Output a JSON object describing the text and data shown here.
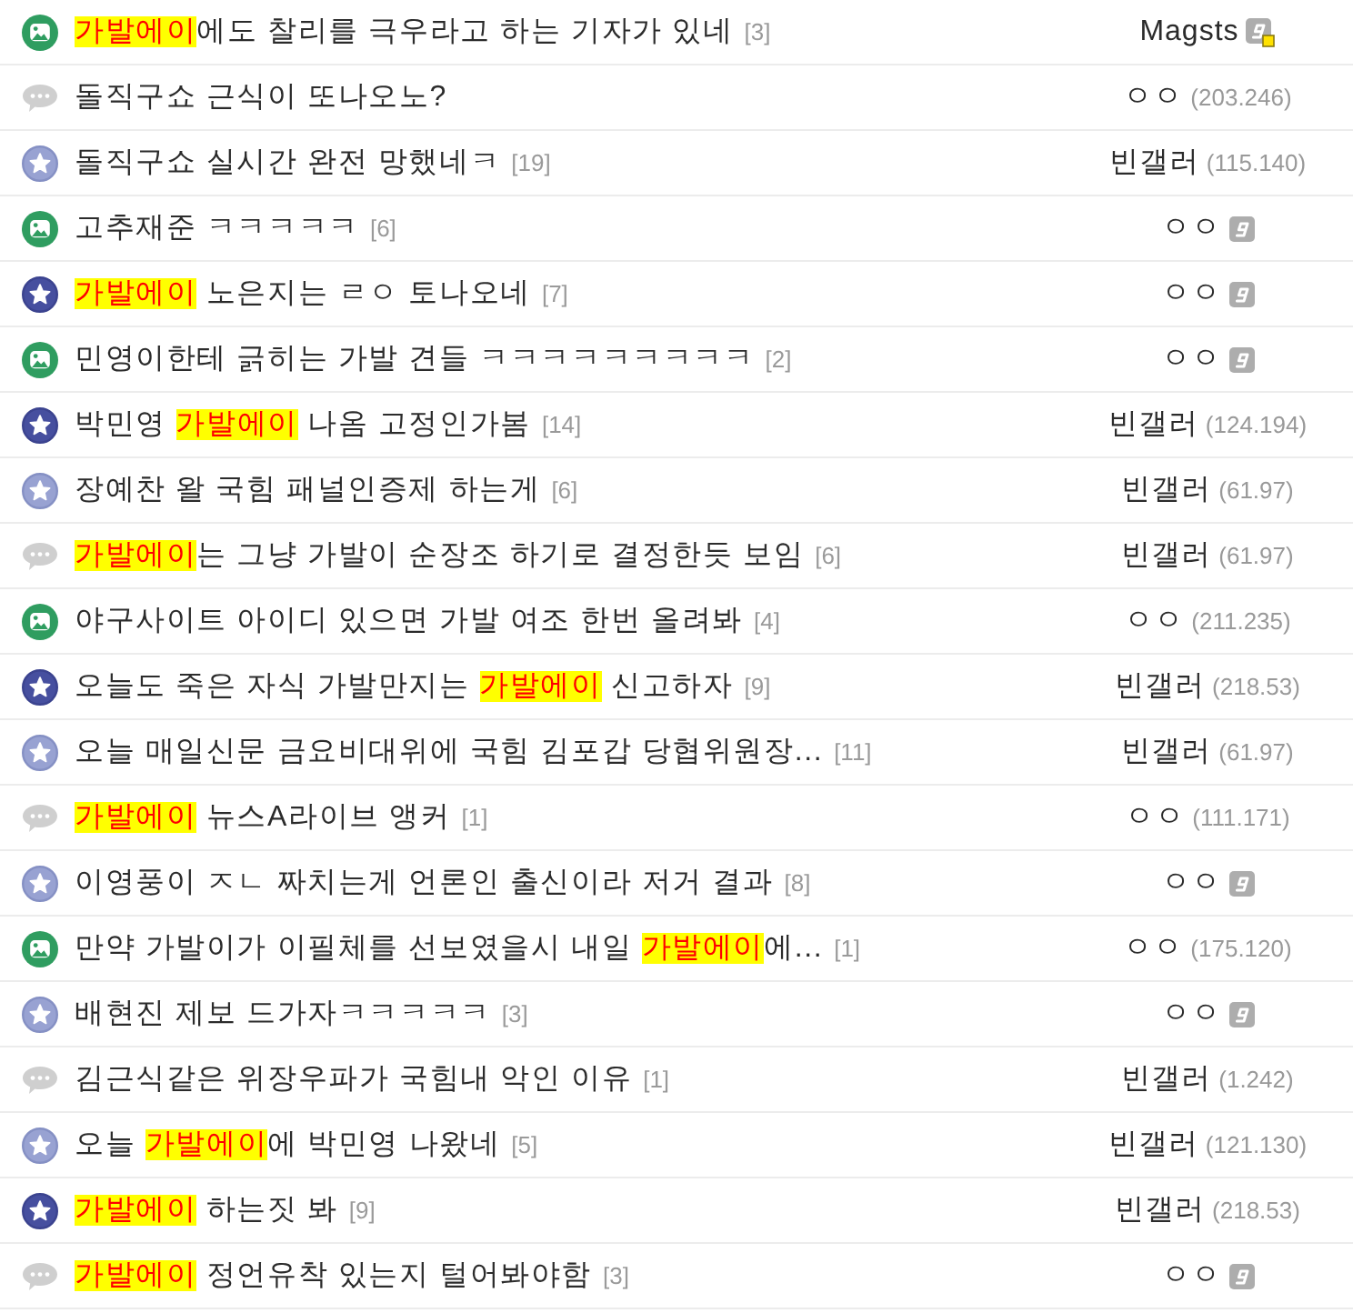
{
  "posts": [
    {
      "kind": "image",
      "title": "**가발에이**에도 찰리를 극우라고 하는 기자가 있네",
      "comments": "[3]",
      "author": {
        "kind": "fixed",
        "name": "Magsts"
      }
    },
    {
      "kind": "text",
      "title": "돌직구쇼 근식이 또나오노?",
      "author": {
        "kind": "guest",
        "name": "ㅇㅇ",
        "ip": "(203.246)"
      }
    },
    {
      "kind": "star",
      "title": "돌직구쇼 실시간 완전 망했네ㅋ",
      "comments": "[19]",
      "author": {
        "kind": "guest",
        "name": "빈갤러",
        "ip": "(115.140)"
      }
    },
    {
      "kind": "image",
      "title": "고추재준 ㅋㅋㅋㅋㅋ",
      "comments": "[6]",
      "author": {
        "kind": "semi-fixed",
        "name": "ㅇㅇ"
      }
    },
    {
      "kind": "star-dark",
      "title": "**가발에이** 노은지는 ㄹㅇ 토나오네",
      "comments": "[7]",
      "author": {
        "kind": "semi-fixed",
        "name": "ㅇㅇ"
      }
    },
    {
      "kind": "image",
      "title": "민영이한테 긁히는 가발 견들 ㅋㅋㅋㅋㅋㅋㅋㅋㅋ",
      "comments": "[2]",
      "author": {
        "kind": "semi-fixed",
        "name": "ㅇㅇ"
      }
    },
    {
      "kind": "star-dark",
      "title": "박민영 **가발에이** 나옴 고정인가봄",
      "comments": "[14]",
      "author": {
        "kind": "guest",
        "name": "빈갤러",
        "ip": "(124.194)"
      }
    },
    {
      "kind": "star",
      "title": "장예찬 왈 국힘 패널인증제 하는게",
      "comments": "[6]",
      "author": {
        "kind": "guest",
        "name": "빈갤러",
        "ip": "(61.97)"
      }
    },
    {
      "kind": "text",
      "title": "**가발에이**는 그냥 가발이 순장조 하기로 결정한듯 보임",
      "comments": "[6]",
      "author": {
        "kind": "guest",
        "name": "빈갤러",
        "ip": "(61.97)"
      }
    },
    {
      "kind": "image",
      "title": "야구사이트 아이디 있으면 가발 여조 한번 올려봐",
      "comments": "[4]",
      "author": {
        "kind": "guest",
        "name": "ㅇㅇ",
        "ip": "(211.235)"
      }
    },
    {
      "kind": "star-dark",
      "title": "오늘도 죽은 자식 가발만지는 **가발에이** 신고하자",
      "comments": "[9]",
      "author": {
        "kind": "guest",
        "name": "빈갤러",
        "ip": "(218.53)"
      }
    },
    {
      "kind": "star",
      "title": "오늘 매일신문 금요비대위에 국힘 김포갑 당협위원장...",
      "comments": "[11]",
      "author": {
        "kind": "guest",
        "name": "빈갤러",
        "ip": "(61.97)"
      }
    },
    {
      "kind": "text",
      "title": "**가발에이** 뉴스A라이브 앵커",
      "comments": "[1]",
      "author": {
        "kind": "guest",
        "name": "ㅇㅇ",
        "ip": "(111.171)"
      }
    },
    {
      "kind": "star",
      "title": "이영풍이 ㅈㄴ 짜치는게 언론인 출신이라 저거 결과",
      "comments": "[8]",
      "author": {
        "kind": "semi-fixed",
        "name": "ㅇㅇ"
      }
    },
    {
      "kind": "image",
      "title": "만약 가발이가 이필체를 선보였을시 내일 **가발에이**에...",
      "comments": "[1]",
      "author": {
        "kind": "guest",
        "name": "ㅇㅇ",
        "ip": "(175.120)"
      }
    },
    {
      "kind": "star",
      "title": "배현진 제보 드가자ㅋㅋㅋㅋㅋ",
      "comments": "[3]",
      "author": {
        "kind": "semi-fixed",
        "name": "ㅇㅇ"
      }
    },
    {
      "kind": "text",
      "title": "김근식같은 위장우파가 국힘내 악인 이유",
      "comments": "[1]",
      "author": {
        "kind": "guest",
        "name": "빈갤러",
        "ip": "(1.242)"
      }
    },
    {
      "kind": "star",
      "title": "오늘 **가발에이**에 박민영 나왔네",
      "comments": "[5]",
      "author": {
        "kind": "guest",
        "name": "빈갤러",
        "ip": "(121.130)"
      }
    },
    {
      "kind": "star-dark",
      "title": "**가발에이** 하는짓 봐",
      "comments": "[9]",
      "author": {
        "kind": "guest",
        "name": "빈갤러",
        "ip": "(218.53)"
      }
    },
    {
      "kind": "text",
      "title": "**가발에이** 정언유착 있는지 털어봐야함",
      "comments": "[3]",
      "author": {
        "kind": "semi-fixed",
        "name": "ㅇㅇ"
      }
    }
  ]
}
